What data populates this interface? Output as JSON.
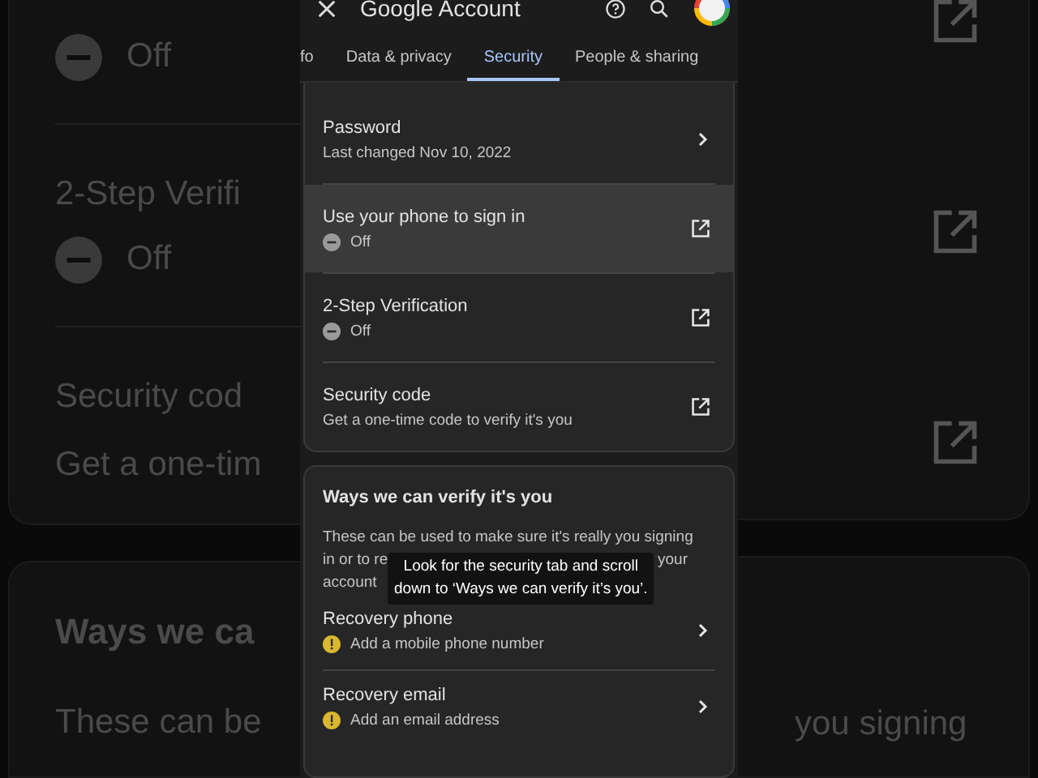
{
  "backdrop": {
    "left_cards": [
      {
        "items": [
          {
            "kind": "status",
            "text": "Off"
          },
          {
            "kind": "divider"
          },
          {
            "kind": "title",
            "text": "2-Step Verifi"
          },
          {
            "kind": "status",
            "text": "Off"
          },
          {
            "kind": "divider"
          },
          {
            "kind": "title",
            "text": "Security cod"
          },
          {
            "kind": "sub",
            "text": "Get a one-tim"
          }
        ]
      },
      {
        "items": [
          {
            "kind": "heading",
            "text": "Ways we ca"
          },
          {
            "kind": "sub",
            "text": "These can be"
          }
        ]
      }
    ],
    "right_text": "you signing"
  },
  "app_bar": {
    "title": "Google Account"
  },
  "tabs": [
    {
      "label": "fo",
      "selected": false
    },
    {
      "label": "Data & privacy",
      "selected": false
    },
    {
      "label": "Security",
      "selected": true
    },
    {
      "label": "People & sharing",
      "selected": false
    }
  ],
  "signin_rows": [
    {
      "title": "Password",
      "kind": "chevron",
      "subtitle": "Last changed Nov 10, 2022",
      "highlighted": false
    },
    {
      "title": "Use your phone to sign in",
      "kind": "external",
      "status": "Off",
      "highlighted": true
    },
    {
      "title": "2-Step Verification",
      "kind": "external",
      "status": "Off",
      "highlighted": false
    },
    {
      "title": "Security code",
      "kind": "external",
      "subtitle": "Get a one-time code to verify it's you",
      "highlighted": false
    }
  ],
  "verify": {
    "heading": "Ways we can verify it's you",
    "description_line_1": "These can be used to make sure it's really you signing",
    "description_line_2_start": "in or to re",
    "description_line_2_end": "your",
    "description_line_3": "account",
    "rows": [
      {
        "title": "Recovery phone",
        "warning": "Add a mobile phone number"
      },
      {
        "title": "Recovery email",
        "warning": "Add an email address"
      }
    ]
  },
  "caption": {
    "lines": [
      "Look for the security tab and scroll",
      "down to ‘Ways we can verify it’s you’."
    ]
  }
}
